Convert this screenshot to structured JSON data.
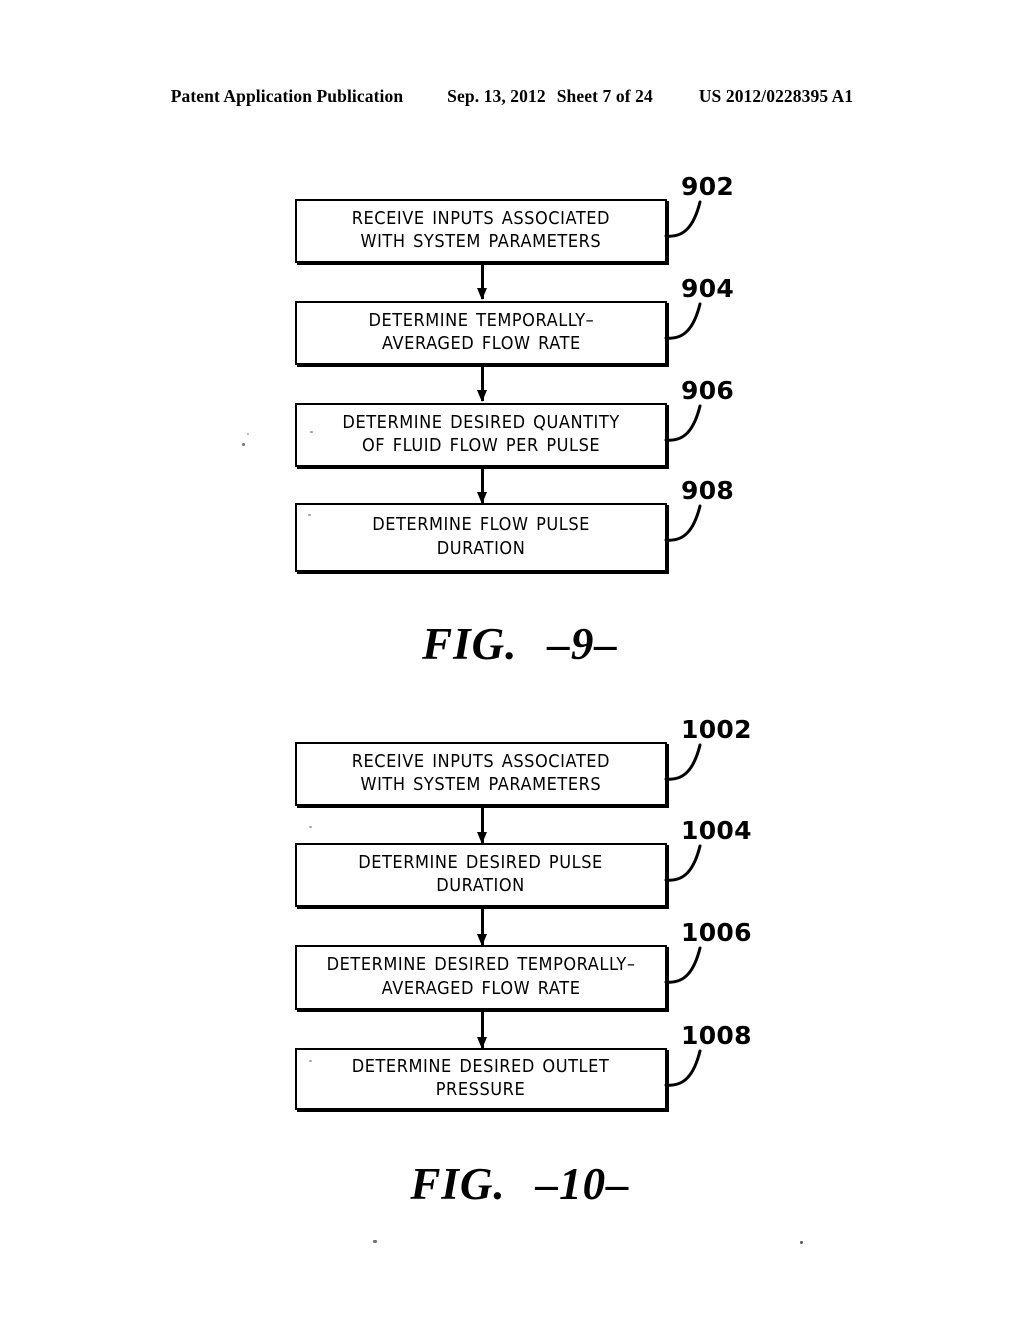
{
  "header": {
    "publication": "Patent Application Publication",
    "date": "Sep. 13, 2012",
    "sheet": "Sheet 7 of 24",
    "number": "US 2012/0228395 A1"
  },
  "figures": [
    {
      "id": "fig-9",
      "caption_word": "FIG.",
      "caption_number": "–9–",
      "steps": [
        {
          "ref": "902",
          "text": "RECEIVE INPUTS ASSOCIATED\nWITH SYSTEM PARAMETERS"
        },
        {
          "ref": "904",
          "text": "DETERMINE TEMPORALLY–\nAVERAGED FLOW RATE"
        },
        {
          "ref": "906",
          "text": "DETERMINE DESIRED QUANTITY\nOF FLUID FLOW PER PULSE"
        },
        {
          "ref": "908",
          "text": "DETERMINE FLOW PULSE\nDURATION"
        }
      ]
    },
    {
      "id": "fig-10",
      "caption_word": "FIG.",
      "caption_number": "–10–",
      "steps": [
        {
          "ref": "1002",
          "text": "RECEIVE INPUTS ASSOCIATED\nWITH SYSTEM PARAMETERS"
        },
        {
          "ref": "1004",
          "text": "DETERMINE DESIRED PULSE\nDURATION"
        },
        {
          "ref": "1006",
          "text": "DETERMINE DESIRED TEMPORALLY–\nAVERAGED FLOW RATE"
        },
        {
          "ref": "1008",
          "text": "DETERMINE DESIRED OUTLET\nPRESSURE"
        }
      ]
    }
  ],
  "colors": {
    "ink": "#000000",
    "paper": "#ffffff"
  }
}
